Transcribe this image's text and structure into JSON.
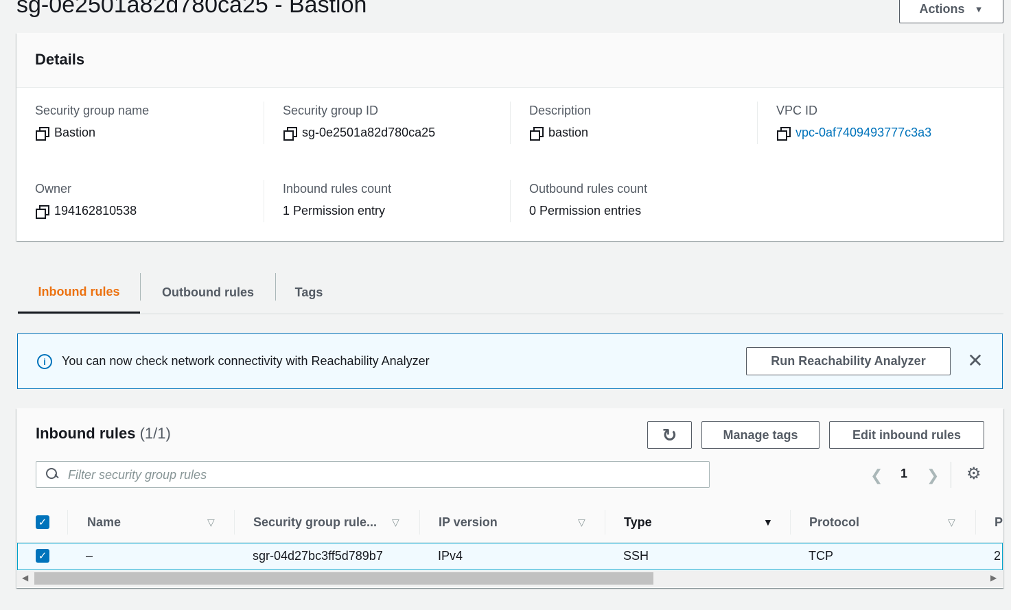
{
  "header": {
    "title": "sg-0e2501a82d780ca25 - Bastion",
    "actions_label": "Actions"
  },
  "details": {
    "heading": "Details",
    "fields": {
      "sg_name": {
        "label": "Security group name",
        "value": "Bastion"
      },
      "sg_id": {
        "label": "Security group ID",
        "value": "sg-0e2501a82d780ca25"
      },
      "description": {
        "label": "Description",
        "value": "bastion"
      },
      "vpc_id": {
        "label": "VPC ID",
        "value": "vpc-0af7409493777c3a3"
      },
      "owner": {
        "label": "Owner",
        "value": "194162810538"
      },
      "inbound_count": {
        "label": "Inbound rules count",
        "value": "1 Permission entry"
      },
      "outbound_count": {
        "label": "Outbound rules count",
        "value": "0 Permission entries"
      }
    }
  },
  "tabs": [
    {
      "label": "Inbound rules",
      "active": true
    },
    {
      "label": "Outbound rules",
      "active": false
    },
    {
      "label": "Tags",
      "active": false
    }
  ],
  "flash": {
    "message": "You can now check network connectivity with Reachability Analyzer",
    "button_label": "Run Reachability Analyzer",
    "close_glyph": "✕",
    "info_glyph": "i"
  },
  "rules_table": {
    "title": "Inbound rules",
    "count": "(1/1)",
    "manage_tags_label": "Manage tags",
    "edit_label": "Edit inbound rules",
    "refresh_glyph": "↻",
    "search_placeholder": "Filter security group rules",
    "page": "1",
    "columns": [
      "Name",
      "Security group rule...",
      "IP version",
      "Type",
      "Protocol",
      "P"
    ],
    "rows": [
      {
        "name": "–",
        "rule_id": "sgr-04d27bc3ff5d789b7",
        "ip_version": "IPv4",
        "type": "SSH",
        "protocol": "TCP",
        "port": "2"
      }
    ]
  },
  "colors": {
    "accent": "#ec7211",
    "link": "#0073bb",
    "selected_row": "#f1faff"
  },
  "icons": [
    "copy-icon",
    "info-icon",
    "close-icon",
    "refresh-icon",
    "search-icon",
    "chevron-left-icon",
    "chevron-right-icon",
    "gear-icon",
    "sort-icon",
    "checkbox-icon",
    "caret-down-icon"
  ]
}
